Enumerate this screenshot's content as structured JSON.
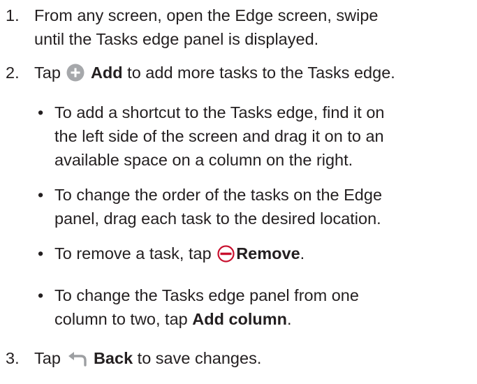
{
  "steps": [
    {
      "number": "1.",
      "line1": "From any screen, open the Edge screen, swipe",
      "line2": "until the Tasks edge panel is displayed."
    },
    {
      "number": "2.",
      "pre": "Tap",
      "action": "Add",
      "post": "to add more tasks to the Tasks edge.",
      "icon": "plus-circle-icon",
      "icon_color": "#a6a8ab"
    },
    {
      "number": "3.",
      "pre": "Tap",
      "action": "Back",
      "post": "to save changes.",
      "icon": "back-arrow-icon",
      "icon_color": "#9d9fa2"
    }
  ],
  "bullets": [
    {
      "marker": "•",
      "lines": [
        "To add a shortcut to the Tasks edge, find it on",
        "the left side of the screen and drag it on to an",
        "available space on a column on the right."
      ]
    },
    {
      "marker": "•",
      "lines": [
        "To change the order of the tasks on the Edge",
        "panel, drag each task to the desired location."
      ]
    },
    {
      "marker": "•",
      "pre": "To remove a task, tap",
      "action": "Remove",
      "post": ".",
      "icon": "minus-circle-icon",
      "icon_color": "#c8102e"
    },
    {
      "marker": "•",
      "line1": "To change the Tasks edge panel from one",
      "pre": "column to two, tap",
      "action": "Add column",
      "post": "."
    }
  ]
}
